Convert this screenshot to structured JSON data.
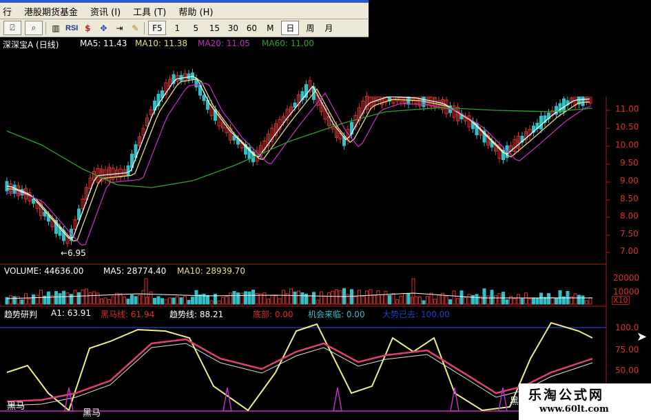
{
  "menu": {
    "items": [
      "行",
      "港股期货基金",
      "资讯 (I)",
      "工具 (T)",
      "帮助 (H)"
    ]
  },
  "toolbar": {
    "rsi_label": "RSI",
    "f5_label": "F5",
    "periods": [
      "1",
      "5",
      "15",
      "30",
      "60",
      "M"
    ],
    "day_label": "日",
    "week_label": "周",
    "month_label": "月"
  },
  "price_panel": {
    "stock_name": "深深宝A (日线)",
    "ma5_label": "MA5: 11.43",
    "ma10_label": "MA10: 11.38",
    "ma20_label": "MA20: 11.05",
    "ma60_label": "MA60: 11.00",
    "low_marker": "←6.95",
    "ticks": [
      "11.00",
      "10.50",
      "10.00",
      "9.50",
      "9.00",
      "8.50",
      "8.00",
      "7.50",
      "7.00"
    ]
  },
  "volume_panel": {
    "volume_label": "VOLUME: 44636.00",
    "ma5_label": "MA5: 28774.40",
    "ma10_label": "MA10: 28939.70",
    "ticks": [
      "20000",
      "10000"
    ],
    "unit": "X10"
  },
  "indicator_panel": {
    "name": "趋势研判",
    "a1_label": "A1: 63.91",
    "heima_label": "黑马线: 61.94",
    "trend_label": "趋势线: 88.21",
    "bottom_label": "底部: 0.00",
    "chance_label": "机会来临: 0.00",
    "extra_label": "大势已去: 100.00",
    "ticks": [
      "100.0",
      "75.00",
      "50.00"
    ],
    "heima_mark_1": "黑马",
    "heima_mark_2": "黑马",
    "heima_mark_3": "黑"
  },
  "watermark": {
    "name": "乐淘公式网",
    "url": "www.60lt.com"
  },
  "colors": {
    "up": "#E03030",
    "down": "#30C0C8",
    "ma5": "#FFFFFF",
    "ma10": "#E8E080",
    "ma20": "#C030C0",
    "ma60": "#30A030",
    "axis": "#B01818",
    "signal": "#F0F080"
  }
}
